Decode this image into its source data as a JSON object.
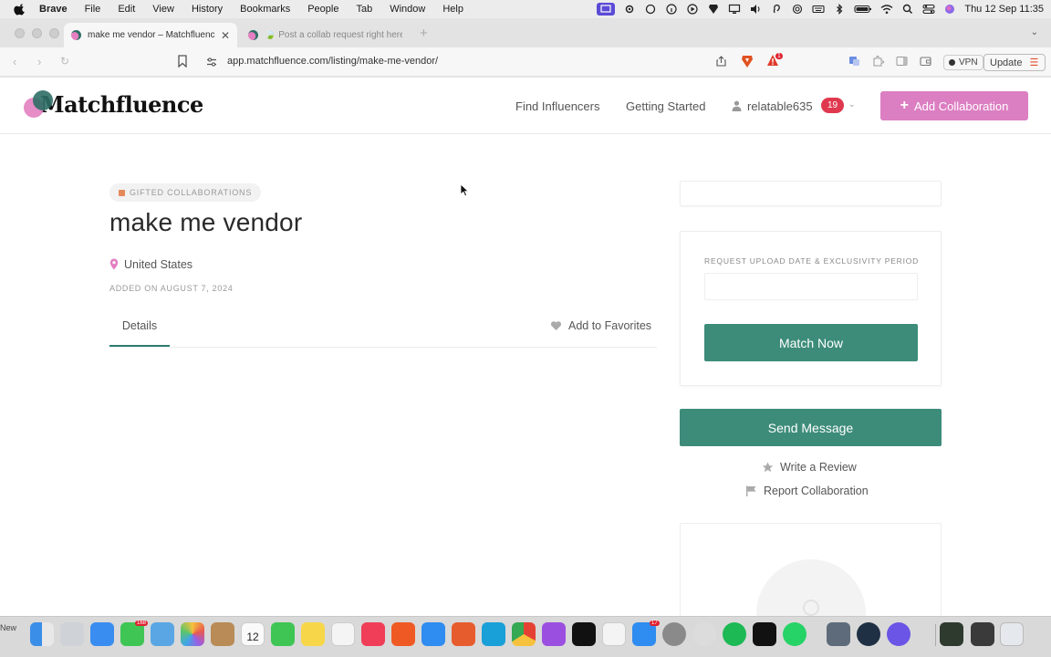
{
  "menubar": {
    "app_name": "Brave",
    "items": [
      "File",
      "Edit",
      "View",
      "History",
      "Bookmarks",
      "People",
      "Tab",
      "Window",
      "Help"
    ],
    "clock": "Thu 12 Sep  11:35",
    "icons": [
      "screen-mirror-icon",
      "gear-icon",
      "cloud-icon",
      "info-icon",
      "play-icon",
      "brave-icon",
      "display-icon",
      "volume-icon",
      "ear-icon",
      "airdrop-icon",
      "keyboard-icon",
      "bluetooth-icon",
      "battery-icon",
      "wifi-icon",
      "search-icon",
      "control-center-icon",
      "siri-icon"
    ]
  },
  "browser": {
    "tabs": [
      {
        "title": "make me vendor – Matchfluence",
        "active": true
      },
      {
        "title": "🍃 Post a collab request right here",
        "active": false
      }
    ],
    "url": "app.matchfluence.com/listing/make-me-vendor/",
    "vpn_label": "VPN",
    "update_label": "Update",
    "shield_badge": "",
    "rewards_badge": "1"
  },
  "site": {
    "logo_text": "Matchfluence",
    "nav": {
      "find_influencers": "Find Influencers",
      "getting_started": "Getting Started",
      "username": "relatable635",
      "notifications": "19",
      "add_collaboration": "Add Collaboration"
    }
  },
  "listing": {
    "category": "GIFTED COLLABORATIONS",
    "title": "make me vendor",
    "location": "United States",
    "added_on": "ADDED ON AUGUST 7, 2024",
    "tab_details": "Details",
    "add_to_favorites": "Add to Favorites"
  },
  "sidebar": {
    "request_label": "REQUEST UPLOAD DATE & EXCLUSIVITY PERIOD",
    "request_value": "",
    "match_now": "Match Now",
    "send_message": "Send Message",
    "write_review": "Write a Review",
    "report_collaboration": "Report Collaboration"
  },
  "dock": {
    "left_label": "New",
    "messages_badge": "168",
    "calendar_day": "12",
    "calendar_month": "SEP",
    "appstore_badge": "17"
  },
  "colors": {
    "accent_pink": "#dc7ec2",
    "accent_teal": "#3d8c7a",
    "notification_red": "#e0394f"
  }
}
